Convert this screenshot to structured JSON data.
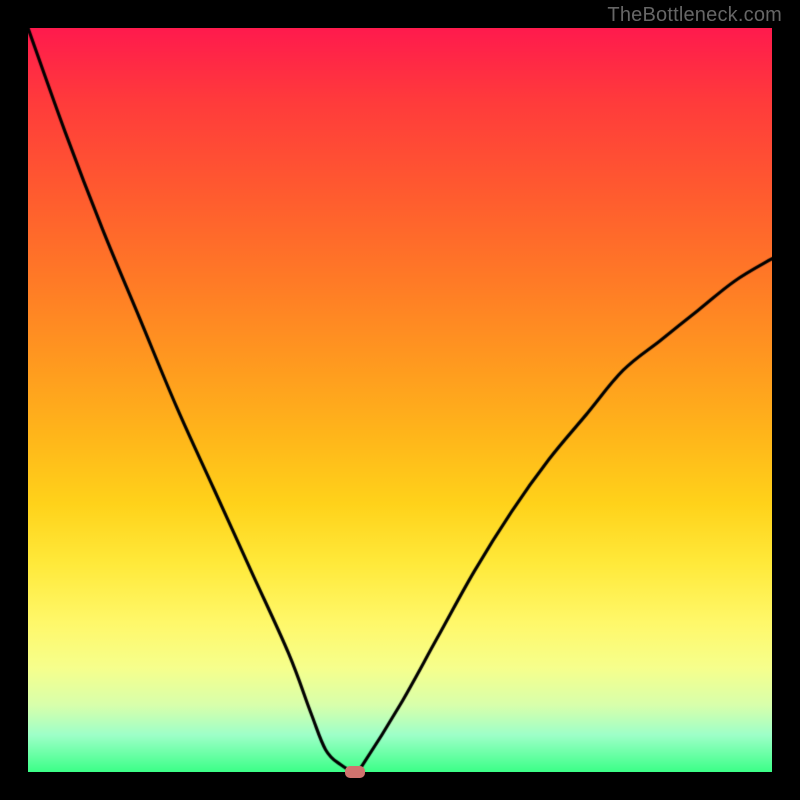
{
  "watermark": "TheBottleneck.com",
  "chart_data": {
    "type": "line",
    "title": "",
    "xlabel": "",
    "ylabel": "",
    "xlim": [
      0,
      100
    ],
    "ylim": [
      0,
      100
    ],
    "series": [
      {
        "name": "curve",
        "x": [
          0,
          5,
          10,
          15,
          20,
          25,
          30,
          35,
          38,
          40,
          42,
          44,
          45,
          50,
          55,
          60,
          65,
          70,
          75,
          80,
          85,
          90,
          95,
          100
        ],
        "values": [
          100,
          86,
          73,
          61,
          49,
          38,
          27,
          16,
          8,
          3,
          1,
          0,
          1,
          9,
          18,
          27,
          35,
          42,
          48,
          54,
          58,
          62,
          66,
          69
        ]
      }
    ],
    "marker": {
      "x": 44,
      "y": 0,
      "color": "#d0736e"
    },
    "background_gradient": {
      "top": "#ff1a4d",
      "bottom": "#3bff87"
    }
  }
}
